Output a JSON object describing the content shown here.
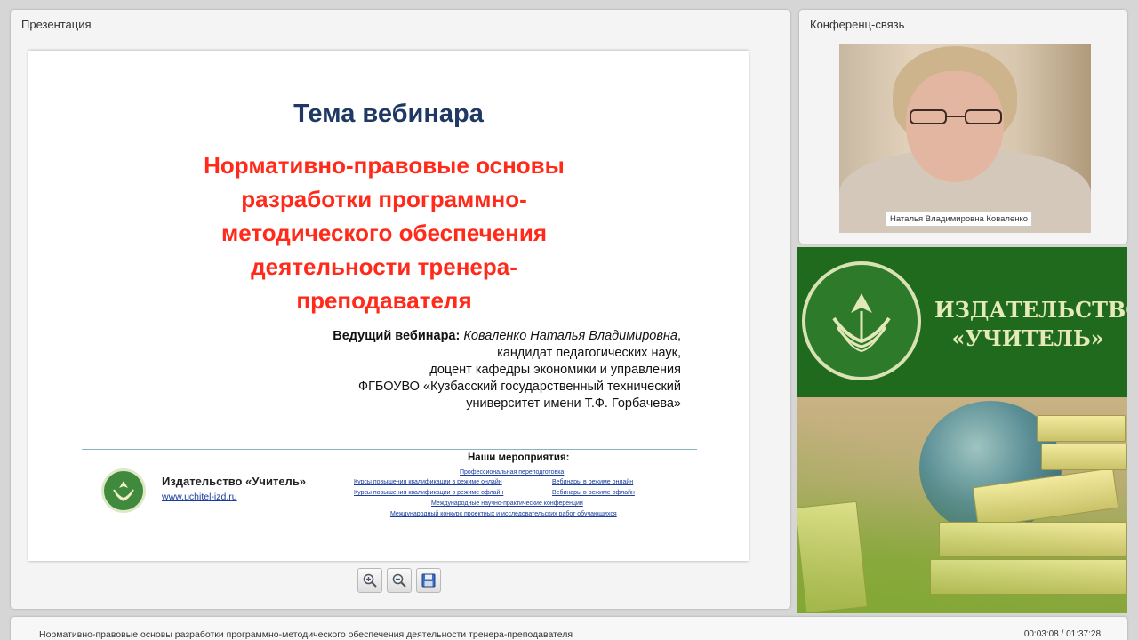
{
  "presentation_panel": {
    "title": "Презентация"
  },
  "slide": {
    "title": "Тема вебинара",
    "topic_lines": [
      "Нормативно-правовые основы",
      "разработки программно-",
      "методического обеспечения",
      "деятельности тренера-",
      "преподавателя"
    ],
    "speaker_label": "Ведущий вебинара:",
    "speaker_name": "Коваленко Наталья Владимировна",
    "speaker_lines": [
      "кандидат педагогических наук,",
      "доцент кафедры экономики и управления",
      "ФГБОУВО  «Кузбасский государственный технический",
      "университет имени Т.Ф. Горбачева»"
    ],
    "brand_name": "Издательство «Учитель»",
    "brand_url": "www.uchitel-izd.ru",
    "events_title": "Наши мероприятия",
    "events": [
      "Профессиональная переподготовка",
      "Курсы повышения квалификации в режиме онлайн",
      "Вебинары в режиме онлайн",
      "Курсы повышения квалификации в режиме офлайн",
      "Вебинары в режиме офлайн",
      "Международные научно-практические конференции",
      "Международный конкурс проектных и исследовательских работ обучающихся"
    ]
  },
  "toolbar": {
    "zoom_in": "zoom-in-icon",
    "zoom_out": "zoom-out-icon",
    "save": "save-icon"
  },
  "conference_panel": {
    "title": "Конференц-связь",
    "participant_name": "Наталья Владимировна Коваленко"
  },
  "banner": {
    "line1": "ИЗДАТЕЛЬСТВО",
    "line2": "«УЧИТЕЛЬ»"
  },
  "footer": {
    "title": "Нормативно-правовые основы разработки программно-методического обеспечения деятельности тренера-преподавателя",
    "time": "00:03:08 / 01:37:28"
  },
  "colors": {
    "slide_title": "#1f3864",
    "slide_topic": "#ff2a1a",
    "brand_green": "#1f6a1d",
    "link_blue": "#1a3c9c"
  }
}
